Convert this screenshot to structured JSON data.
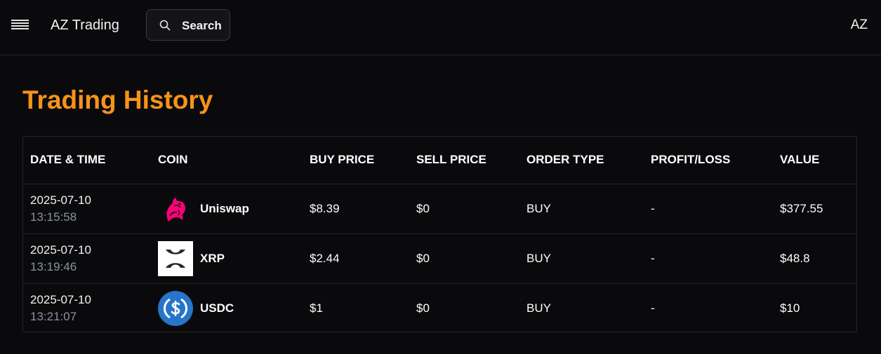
{
  "header": {
    "brand": "AZ Trading",
    "search_label": "Search",
    "avatar_initials": "AZ",
    "menu_icon": "hamburger-menu-icon",
    "search_icon": "search-icon"
  },
  "page": {
    "title": "Trading History",
    "title_color": "#f7931a"
  },
  "table": {
    "columns": [
      "DATE & TIME",
      "COIN",
      "BUY PRICE",
      "SELL PRICE",
      "ORDER TYPE",
      "PROFIT/LOSS",
      "VALUE"
    ],
    "rows": [
      {
        "date": "2025-07-10",
        "time": "13:15:58",
        "coin": "Uniswap",
        "coin_icon": "uniswap-logo",
        "buy_price": "$8.39",
        "sell_price": "$0",
        "order_type": "BUY",
        "profit_loss": "-",
        "value": "$377.55"
      },
      {
        "date": "2025-07-10",
        "time": "13:19:46",
        "coin": "XRP",
        "coin_icon": "xrp-logo",
        "buy_price": "$2.44",
        "sell_price": "$0",
        "order_type": "BUY",
        "profit_loss": "-",
        "value": "$48.8"
      },
      {
        "date": "2025-07-10",
        "time": "13:21:07",
        "coin": "USDC",
        "coin_icon": "usdc-logo",
        "buy_price": "$1",
        "sell_price": "$0",
        "order_type": "BUY",
        "profit_loss": "-",
        "value": "$10"
      }
    ]
  }
}
